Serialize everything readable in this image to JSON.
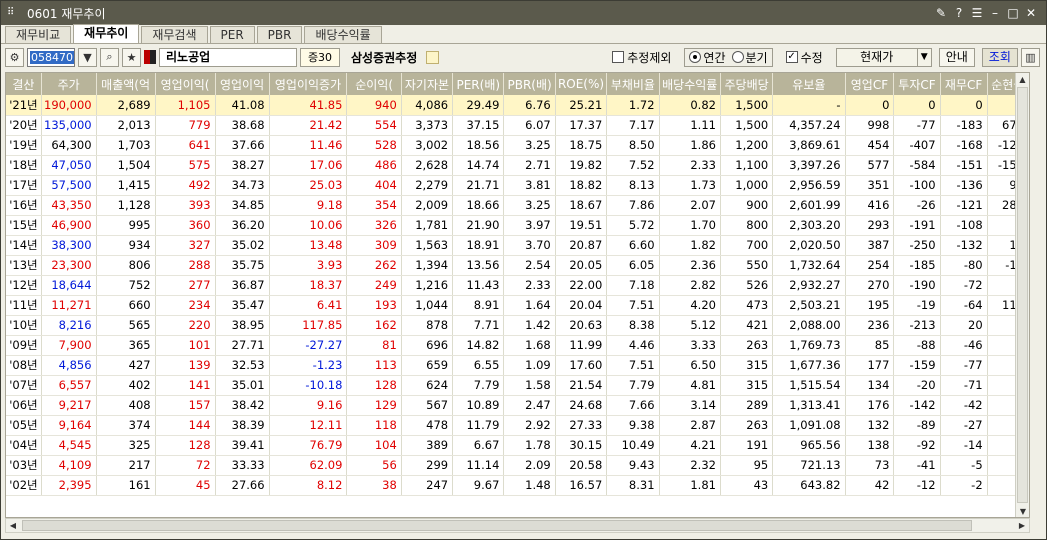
{
  "window": {
    "title": "0601 재무추이"
  },
  "tabs": [
    "재무비교",
    "재무추이",
    "재무검색",
    "PER",
    "PBR",
    "배당수익률"
  ],
  "toolbar": {
    "code": "058470",
    "stock_name": "리노공업",
    "market": "증30",
    "broker": "삼성증권추정",
    "exclude_estimate": "추정제외",
    "annual": "연간",
    "quarter": "분기",
    "revised": "수정",
    "price_mode": "현재가",
    "guide": "안내",
    "query": "조회"
  },
  "table": {
    "headers": [
      "결산",
      "주가",
      "매출액(억",
      "영업이익(",
      "영업이익",
      "영업이익증가",
      "순이익(",
      "자기자본",
      "PER(배)",
      "PBR(배)",
      "ROE(%)",
      "부채비율",
      "배당수익률",
      "주당배당",
      "유보율",
      "영업CF",
      "투자CF",
      "재무CF",
      "순현금"
    ],
    "rows": [
      [
        "'21년",
        "190,000",
        "2,689",
        "1,105",
        "41.08",
        "41.85",
        "940",
        "4,086",
        "29.49",
        "6.76",
        "25.21",
        "1.72",
        "0.82",
        "1,500",
        "-",
        "0",
        "0",
        "0",
        "0"
      ],
      [
        "'20년",
        "135,000",
        "2,013",
        "779",
        "38.68",
        "21.42",
        "554",
        "3,373",
        "37.15",
        "6.07",
        "17.37",
        "7.17",
        "1.11",
        "1,500",
        "4,357.24",
        "998",
        "-77",
        "-183",
        "676"
      ],
      [
        "'19년",
        "64,300",
        "1,703",
        "641",
        "37.66",
        "11.46",
        "528",
        "3,002",
        "18.56",
        "3.25",
        "18.75",
        "8.50",
        "1.86",
        "1,200",
        "3,869.61",
        "454",
        "-407",
        "-168",
        "-123"
      ],
      [
        "'18년",
        "47,050",
        "1,504",
        "575",
        "38.27",
        "17.06",
        "486",
        "2,628",
        "14.74",
        "2.71",
        "19.82",
        "7.52",
        "2.33",
        "1,100",
        "3,397.26",
        "577",
        "-584",
        "-151",
        "-158"
      ],
      [
        "'17년",
        "57,500",
        "1,415",
        "492",
        "34.73",
        "25.03",
        "404",
        "2,279",
        "21.71",
        "3.81",
        "18.82",
        "8.13",
        "1.73",
        "1,000",
        "2,956.59",
        "351",
        "-100",
        "-136",
        "99"
      ],
      [
        "'16년",
        "43,350",
        "1,128",
        "393",
        "34.85",
        "9.18",
        "354",
        "2,009",
        "18.66",
        "3.25",
        "18.67",
        "7.86",
        "2.07",
        "900",
        "2,601.99",
        "416",
        "-26",
        "-121",
        "283"
      ],
      [
        "'15년",
        "46,900",
        "995",
        "360",
        "36.20",
        "10.06",
        "326",
        "1,781",
        "21.90",
        "3.97",
        "19.51",
        "5.72",
        "1.70",
        "800",
        "2,303.20",
        "293",
        "-191",
        "-108",
        "1"
      ],
      [
        "'14년",
        "38,300",
        "934",
        "327",
        "35.02",
        "13.48",
        "309",
        "1,563",
        "18.91",
        "3.70",
        "20.87",
        "6.60",
        "1.82",
        "700",
        "2,020.50",
        "387",
        "-250",
        "-132",
        "11"
      ],
      [
        "'13년",
        "23,300",
        "806",
        "288",
        "35.75",
        "3.93",
        "262",
        "1,394",
        "13.56",
        "2.54",
        "20.05",
        "6.05",
        "2.36",
        "550",
        "1,732.64",
        "254",
        "-185",
        "-80",
        "-13"
      ],
      [
        "'12년",
        "18,644",
        "752",
        "277",
        "36.87",
        "18.37",
        "249",
        "1,216",
        "11.43",
        "2.33",
        "22.00",
        "7.18",
        "2.82",
        "526",
        "2,932.27",
        "270",
        "-190",
        "-72",
        "6"
      ],
      [
        "'11년",
        "11,271",
        "660",
        "234",
        "35.47",
        "6.41",
        "193",
        "1,044",
        "8.91",
        "1.64",
        "20.04",
        "7.51",
        "4.20",
        "473",
        "2,503.21",
        "195",
        "-19",
        "-64",
        "114"
      ],
      [
        "'10년",
        "8,216",
        "565",
        "220",
        "38.95",
        "117.85",
        "162",
        "878",
        "7.71",
        "1.42",
        "20.63",
        "8.38",
        "5.12",
        "421",
        "2,088.00",
        "236",
        "-213",
        "20",
        "0"
      ],
      [
        "'09년",
        "7,900",
        "365",
        "101",
        "27.71",
        "-27.27",
        "81",
        "696",
        "14.82",
        "1.68",
        "11.99",
        "4.46",
        "3.33",
        "263",
        "1,769.73",
        "85",
        "-88",
        "-46",
        "0"
      ],
      [
        "'08년",
        "4,856",
        "427",
        "139",
        "32.53",
        "-1.23",
        "113",
        "659",
        "6.55",
        "1.09",
        "17.60",
        "7.51",
        "6.50",
        "315",
        "1,677.36",
        "177",
        "-159",
        "-77",
        "0"
      ],
      [
        "'07년",
        "6,557",
        "402",
        "141",
        "35.01",
        "-10.18",
        "128",
        "624",
        "7.79",
        "1.58",
        "21.54",
        "7.79",
        "4.81",
        "315",
        "1,515.54",
        "134",
        "-20",
        "-71",
        "0"
      ],
      [
        "'06년",
        "9,217",
        "408",
        "157",
        "38.42",
        "9.16",
        "129",
        "567",
        "10.89",
        "2.47",
        "24.68",
        "7.66",
        "3.14",
        "289",
        "1,313.41",
        "176",
        "-142",
        "-42",
        "0"
      ],
      [
        "'05년",
        "9,164",
        "374",
        "144",
        "38.39",
        "12.11",
        "118",
        "478",
        "11.79",
        "2.92",
        "27.33",
        "9.38",
        "2.87",
        "263",
        "1,091.08",
        "132",
        "-89",
        "-27",
        "0"
      ],
      [
        "'04년",
        "4,545",
        "325",
        "128",
        "39.41",
        "76.79",
        "104",
        "389",
        "6.67",
        "1.78",
        "30.15",
        "10.49",
        "4.21",
        "191",
        "965.56",
        "138",
        "-92",
        "-14",
        "0"
      ],
      [
        "'03년",
        "4,109",
        "217",
        "72",
        "33.33",
        "62.09",
        "56",
        "299",
        "11.14",
        "2.09",
        "20.58",
        "9.43",
        "2.32",
        "95",
        "721.13",
        "73",
        "-41",
        "-5",
        "0"
      ],
      [
        "'02년",
        "2,395",
        "161",
        "45",
        "27.66",
        "8.12",
        "38",
        "247",
        "9.67",
        "1.48",
        "16.57",
        "8.31",
        "1.81",
        "43",
        "643.82",
        "42",
        "-12",
        "-2",
        "0"
      ]
    ],
    "price_colors": [
      "red",
      "blue",
      "black",
      "blue",
      "blue",
      "red",
      "red",
      "blue",
      "red",
      "blue",
      "red",
      "blue",
      "red",
      "blue",
      "red",
      "red",
      "red",
      "red",
      "red",
      "red"
    ],
    "growth_colors": [
      "red",
      "red",
      "red",
      "red",
      "red",
      "red",
      "red",
      "red",
      "red",
      "red",
      "red",
      "red",
      "blue",
      "blue",
      "blue",
      "red",
      "red",
      "red",
      "red",
      "red"
    ]
  }
}
